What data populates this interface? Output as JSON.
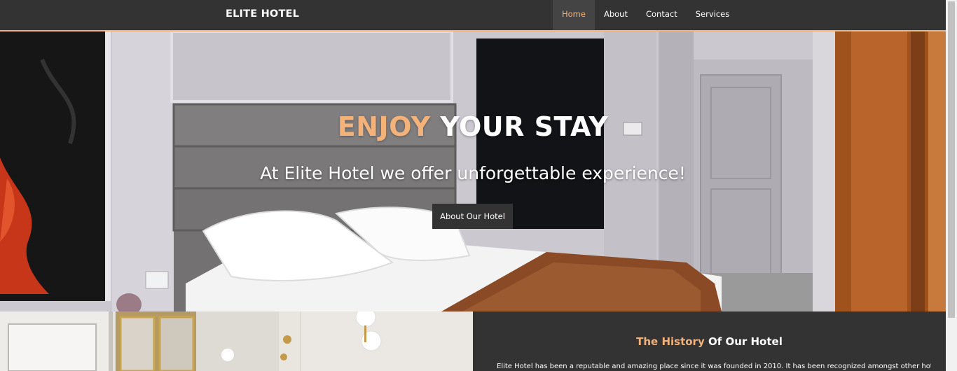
{
  "navbar": {
    "brand": "ELITE HOTEL",
    "links": [
      {
        "label": "Home",
        "active": true
      },
      {
        "label": "About"
      },
      {
        "label": "Contact"
      },
      {
        "label": "Services"
      }
    ]
  },
  "hero": {
    "title_accent": "ENJOY",
    "title_rest": " YOUR STAY",
    "subtitle": "At Elite Hotel we offer unforgettable experience!",
    "button_label": "About Our Hotel"
  },
  "history": {
    "title_accent": "The History",
    "title_rest": " Of Our Hotel",
    "text": "Elite Hotel has been a reputable and amazing place since it was founded in 2010. It has been recognized amongst other hotels in"
  },
  "colors": {
    "accent": "#f2b27a",
    "dark": "#333333",
    "active_nav_bg": "#444444"
  }
}
